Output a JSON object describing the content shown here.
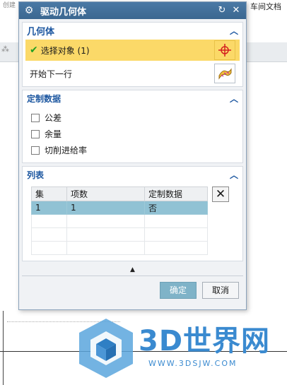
{
  "background": {
    "left_text": "创建",
    "right_text": "车间文档"
  },
  "dialog": {
    "title": "驱动几何体",
    "geometry_section": {
      "header": "几何体",
      "select_object_label": "选择对象 (1)",
      "start_next_row_label": "开始下一行"
    },
    "custom_data_section": {
      "header": "定制数据",
      "checkboxes": [
        {
          "label": "公差",
          "checked": false
        },
        {
          "label": "余量",
          "checked": false
        },
        {
          "label": "切削进给率",
          "checked": false
        }
      ]
    },
    "list_section": {
      "header": "列表",
      "columns": [
        "集",
        "项数",
        "定制数据"
      ],
      "rows": [
        {
          "set": "1",
          "count": "1",
          "custom": "否"
        }
      ]
    },
    "footer": {
      "ok_label": "确定",
      "cancel_label": "取消"
    }
  },
  "watermark": {
    "brand": "3D世界网",
    "url": "WWW.3DSJW.COM"
  },
  "colors": {
    "titlebar": "#4a79a5",
    "section_header": "#1d57a0",
    "selection_highlight": "#fbd968",
    "table_selected_row": "#91c2d4",
    "primary_button": "#7fb3c8",
    "watermark": "#3a8ad0"
  }
}
